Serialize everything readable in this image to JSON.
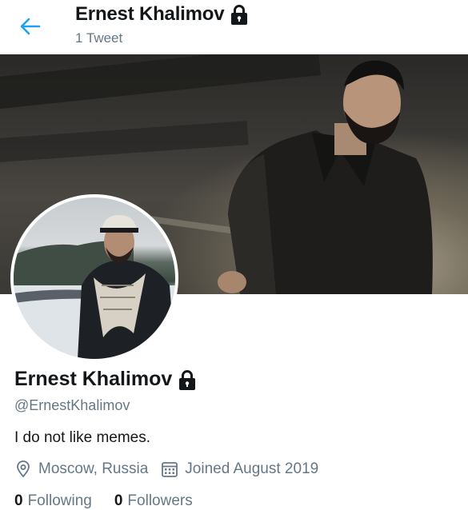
{
  "header": {
    "title": "Ernest Khalimov",
    "tweet_count": "1 Tweet"
  },
  "profile": {
    "name": "Ernest Khalimov",
    "handle": "@ErnestKhalimov",
    "bio": "I do not like memes.",
    "location": "Moscow, Russia",
    "joined": "Joined August 2019",
    "following_count": "0",
    "following_label": "Following",
    "followers_count": "0",
    "followers_label": "Followers"
  },
  "colors": {
    "accent": "#1da1f2",
    "secondary_text": "#657786",
    "primary_text": "#14171a"
  },
  "icons": {
    "back": "arrow-left-icon",
    "lock": "lock-icon",
    "location": "location-pin-icon",
    "calendar": "calendar-icon"
  }
}
